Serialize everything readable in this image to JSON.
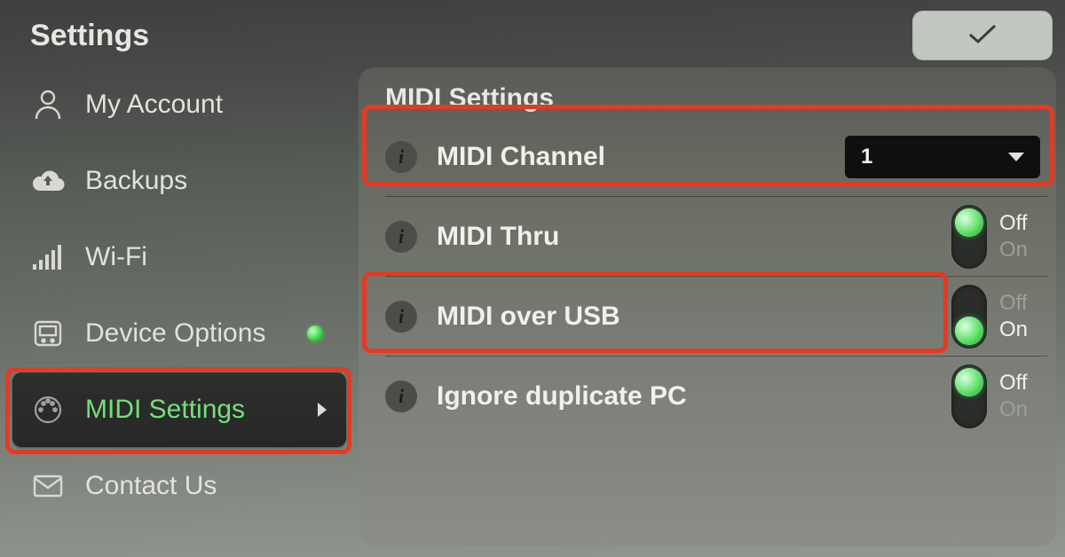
{
  "header": {
    "title": "Settings"
  },
  "sidebar": {
    "items": [
      {
        "key": "my-account",
        "label": "My Account",
        "active": false,
        "indicator": false
      },
      {
        "key": "backups",
        "label": "Backups",
        "active": false,
        "indicator": false
      },
      {
        "key": "wifi",
        "label": "Wi-Fi",
        "active": false,
        "indicator": false
      },
      {
        "key": "device-options",
        "label": "Device Options",
        "active": false,
        "indicator": true
      },
      {
        "key": "midi-settings",
        "label": "MIDI Settings",
        "active": true,
        "indicator": false
      },
      {
        "key": "contact-us",
        "label": "Contact Us",
        "active": false,
        "indicator": false
      }
    ]
  },
  "main": {
    "title": "MIDI Settings",
    "midi_channel": {
      "label": "MIDI Channel",
      "value": "1"
    },
    "midi_thru": {
      "label": "MIDI Thru",
      "state": "off"
    },
    "midi_over_usb": {
      "label": "MIDI over USB",
      "state": "on"
    },
    "ignore_dup_pc": {
      "label": "Ignore duplicate PC",
      "state": "off"
    },
    "labels": {
      "off": "Off",
      "on": "On"
    }
  },
  "icons": {
    "info_glyph": "i"
  }
}
